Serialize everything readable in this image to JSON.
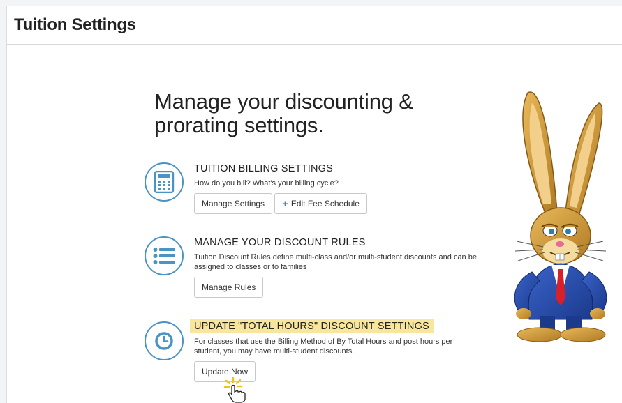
{
  "page": {
    "title": "Tuition Settings"
  },
  "headline": [
    "Manage your discounting &",
    "prorating settings."
  ],
  "sections": [
    {
      "title": "TUITION BILLING SETTINGS",
      "description": "How do you bill? What's your billing cycle?",
      "icon": "calculator-icon",
      "buttons": [
        {
          "label": "Manage Settings"
        },
        {
          "label": "Edit Fee Schedule",
          "icon": "plus-icon"
        }
      ]
    },
    {
      "title": "MANAGE YOUR DISCOUNT RULES",
      "description": "Tuition Discount Rules define multi-class and/or multi-student discounts and can be assigned to classes or to families",
      "icon": "list-icon",
      "buttons": [
        {
          "label": "Manage Rules"
        }
      ]
    },
    {
      "title": "UPDATE \"TOTAL HOURS\" DISCOUNT SETTINGS",
      "description": "For classes that use the Billing Method of By Total Hours and post hours per student, you may have multi-student discounts.",
      "icon": "clock-icon",
      "highlighted": true,
      "highlight_color": "#f7e69c",
      "buttons": [
        {
          "label": "Update Now"
        }
      ]
    }
  ],
  "colors": {
    "accent": "#4a93c5",
    "highlight": "#f7e69c",
    "plus": "#3a85c6"
  },
  "mascot": "rabbit-mascot",
  "cursor": "hand-pointer-icon"
}
